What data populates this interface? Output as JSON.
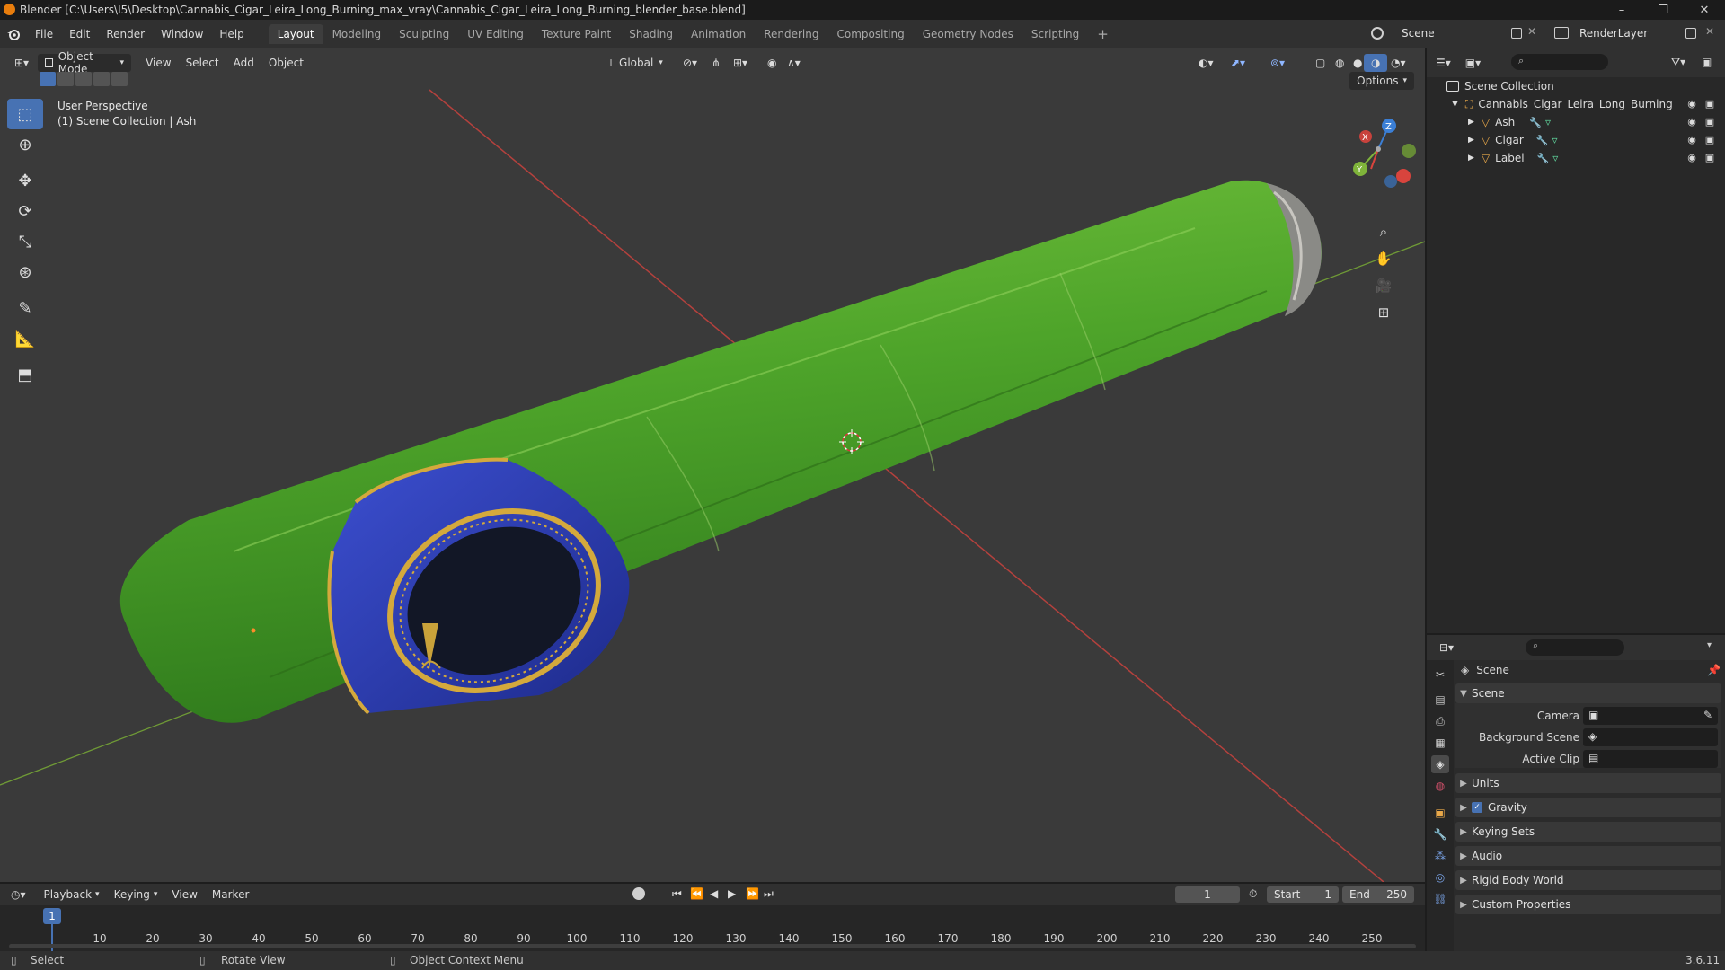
{
  "window": {
    "title": "Blender [C:\\Users\\I5\\Desktop\\Cannabis_Cigar_Leira_Long_Burning_max_vray\\Cannabis_Cigar_Leira_Long_Burning_blender_base.blend]",
    "minimize": "–",
    "maximize": "❐",
    "close": "✕"
  },
  "menu": [
    "File",
    "Edit",
    "Render",
    "Window",
    "Help"
  ],
  "workspaces": [
    {
      "label": "Layout",
      "active": true
    },
    {
      "label": "Modeling",
      "active": false
    },
    {
      "label": "Sculpting",
      "active": false
    },
    {
      "label": "UV Editing",
      "active": false
    },
    {
      "label": "Texture Paint",
      "active": false
    },
    {
      "label": "Shading",
      "active": false
    },
    {
      "label": "Animation",
      "active": false
    },
    {
      "label": "Rendering",
      "active": false
    },
    {
      "label": "Compositing",
      "active": false
    },
    {
      "label": "Geometry Nodes",
      "active": false
    },
    {
      "label": "Scripting",
      "active": false
    }
  ],
  "add_workspace": "+",
  "scene_selector": "Scene",
  "view_layer": "RenderLayer",
  "viewport": {
    "mode": "Object Mode",
    "menus": [
      "View",
      "Select",
      "Add",
      "Object"
    ],
    "orientation": "Global",
    "options": "Options",
    "view_name": "User Perspective",
    "collection_info": "(1) Scene Collection | Ash",
    "gizmo_labels": {
      "x": "X",
      "y": "Y",
      "z": "Z"
    }
  },
  "outliner": {
    "root": "Scene Collection",
    "collection": "Cannabis_Cigar_Leira_Long_Burning",
    "objects": [
      "Ash",
      "Cigar",
      "Label"
    ]
  },
  "properties": {
    "context": "Scene",
    "panel_scene": "Scene",
    "camera_label": "Camera",
    "background_label": "Background Scene",
    "clip_label": "Active Clip",
    "sections": [
      "Units",
      "Gravity",
      "Keying Sets",
      "Audio",
      "Rigid Body World",
      "Custom Properties"
    ],
    "gravity_checked": true
  },
  "timeline": {
    "menus": [
      "Playback",
      "Keying",
      "View",
      "Marker"
    ],
    "current_frame": "1",
    "start_label": "Start",
    "start": "1",
    "end_label": "End",
    "end": "250",
    "ticks": [
      "1",
      "10",
      "20",
      "30",
      "40",
      "50",
      "60",
      "70",
      "80",
      "90",
      "100",
      "110",
      "120",
      "130",
      "140",
      "150",
      "160",
      "170",
      "180",
      "190",
      "200",
      "210",
      "220",
      "230",
      "240",
      "250"
    ]
  },
  "statusbar": {
    "select": "Select",
    "rotate": "Rotate View",
    "context_menu": "Object Context Menu",
    "version": "3.6.11"
  },
  "colors": {
    "accent": "#4772b3",
    "cigar_green": "#4fa82a",
    "band_blue": "#2c3fa8",
    "band_gold": "#c9a23a",
    "axis_x": "#d8443d",
    "axis_y": "#7fb43a",
    "axis_z": "#3b7fd6"
  }
}
